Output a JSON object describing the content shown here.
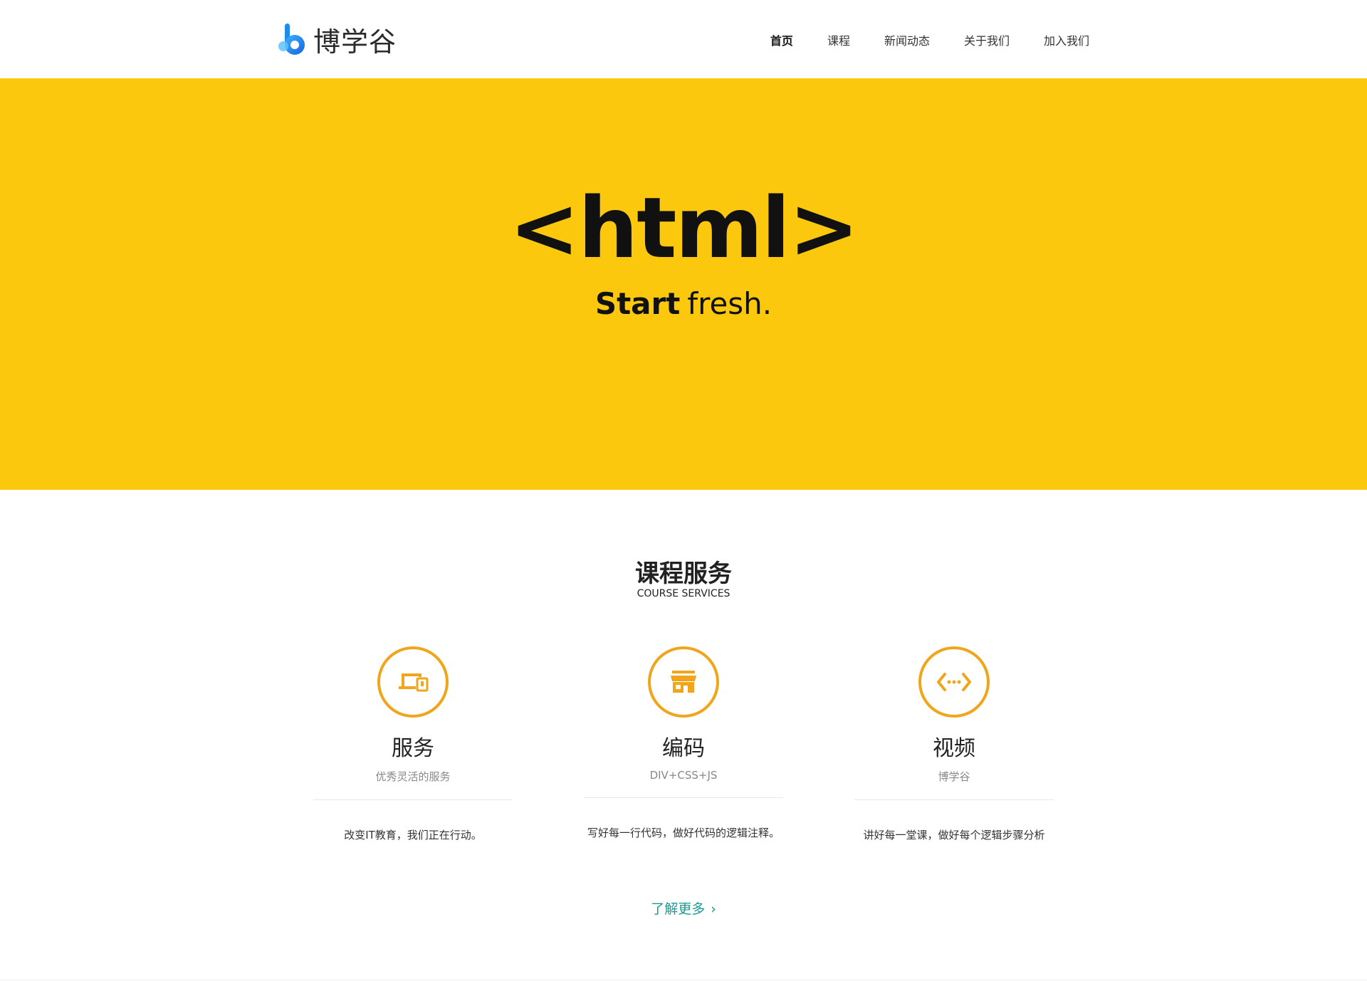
{
  "logo": {
    "text": "博学谷",
    "brand_color": "#1e8bef"
  },
  "nav": {
    "items": [
      {
        "label": "首页",
        "active": true
      },
      {
        "label": "课程",
        "active": false
      },
      {
        "label": "新闻动态",
        "active": false
      },
      {
        "label": "关于我们",
        "active": false
      },
      {
        "label": "加入我们",
        "active": false
      }
    ]
  },
  "hero": {
    "background": "#fbc80e",
    "code": "<html>",
    "tagline_bold": "Start",
    "tagline_light": "fresh."
  },
  "services": {
    "title": "课程服务",
    "subtitle": "COURSE SERVICES",
    "accent_color": "#f0a51a",
    "items": [
      {
        "icon": "devices-icon",
        "title": "服务",
        "sub": "优秀灵活的服务",
        "desc": "改变IT教育，我们正在行动。"
      },
      {
        "icon": "store-icon",
        "title": "编码",
        "sub": "DIV+CSS+JS",
        "desc": "写好每一行代码，做好代码的逻辑注释。"
      },
      {
        "icon": "code-icon",
        "title": "视频",
        "sub": "博学谷",
        "desc": "讲好每一堂课，做好每个逻辑步骤分析"
      }
    ],
    "more_label": "了解更多",
    "more_color": "#1a9a92"
  }
}
